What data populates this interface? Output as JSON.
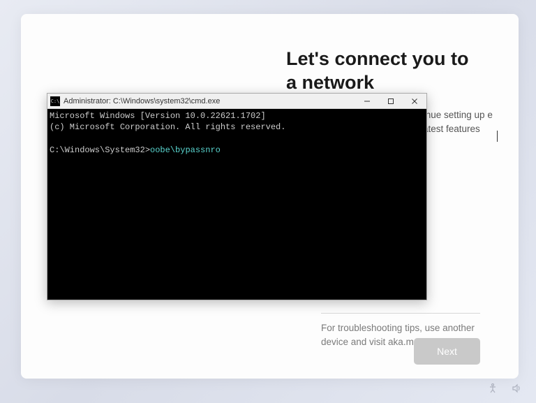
{
  "oobe": {
    "heading": "Let's connect you to a network",
    "subtitle_partial": "tinue setting up\ne latest features",
    "troubleshoot": "For troubleshooting tips, use another device and visit aka.ms/networksetup",
    "next_label": "Next"
  },
  "cmd": {
    "title": "Administrator: C:\\Windows\\system32\\cmd.exe",
    "line1": "Microsoft Windows [Version 10.0.22621.1702]",
    "line2": "(c) Microsoft Corporation. All rights reserved.",
    "prompt": "C:\\Windows\\System32>",
    "command": "oobe\\bypassnro"
  }
}
